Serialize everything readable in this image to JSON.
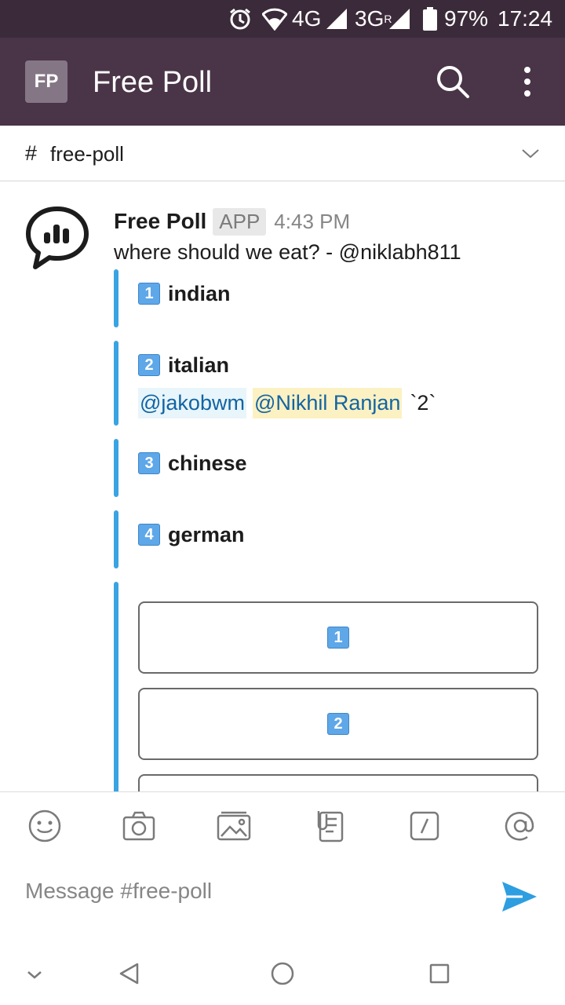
{
  "status_bar": {
    "network1": "4G",
    "network2": "3G",
    "network2_sup": "R",
    "battery": "97%",
    "time": "17:24",
    "icons": [
      "alarm-icon",
      "wifi-icon",
      "signal-icon",
      "battery-icon"
    ]
  },
  "app_bar": {
    "workspace_initials": "FP",
    "title": "Free Poll",
    "icons": [
      "search-icon",
      "more-vert-icon"
    ]
  },
  "channel": {
    "hash": "#",
    "name": "free-poll"
  },
  "message": {
    "sender": "Free Poll",
    "badge": "APP",
    "time": "4:43 PM",
    "text": "where should we eat? - @niklabh811",
    "options": [
      {
        "key": "1",
        "label": "indian"
      },
      {
        "key": "2",
        "label": "italian"
      },
      {
        "key": "3",
        "label": "chinese"
      },
      {
        "key": "4",
        "label": "german"
      }
    ],
    "voters": {
      "mention1": "@jakobwm",
      "mention2": "@Nikhil Ranjan",
      "count": "`2`"
    },
    "vote_buttons": [
      "1",
      "2",
      ""
    ]
  },
  "composer": {
    "placeholder": "Message #free-poll",
    "tools": [
      "emoji-icon",
      "camera-icon",
      "gallery-icon",
      "file-icon",
      "slash-command-icon",
      "mention-icon"
    ]
  },
  "colors": {
    "status_bar": "#3b2b3a",
    "app_bar": "#4a3448",
    "attachment_bar": "#3aa3e3",
    "mention": "#1264a3",
    "send": "#2d9ee0"
  }
}
